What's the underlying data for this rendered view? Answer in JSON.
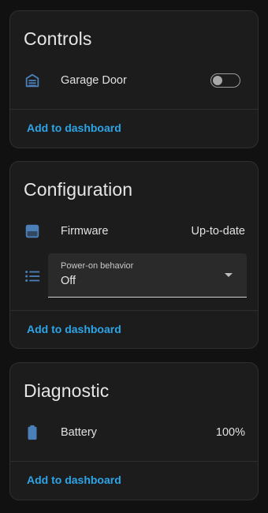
{
  "theme": {
    "accent": "#2ea4e6",
    "icon_color": "#4a7fb8",
    "card_bg": "#1c1c1c",
    "page_bg": "#111111"
  },
  "controls": {
    "title": "Controls",
    "entities": [
      {
        "icon": "garage-icon",
        "label": "Garage Door",
        "state": "off"
      }
    ],
    "action_label": "Add to dashboard"
  },
  "configuration": {
    "title": "Configuration",
    "firmware": {
      "icon": "firmware-icon",
      "label": "Firmware",
      "value": "Up-to-date"
    },
    "power_on": {
      "icon": "list-icon",
      "label": "Power-on behavior",
      "value": "Off"
    },
    "action_label": "Add to dashboard"
  },
  "diagnostic": {
    "title": "Diagnostic",
    "battery": {
      "icon": "battery-icon",
      "label": "Battery",
      "value": "100%"
    },
    "action_label": "Add to dashboard"
  }
}
